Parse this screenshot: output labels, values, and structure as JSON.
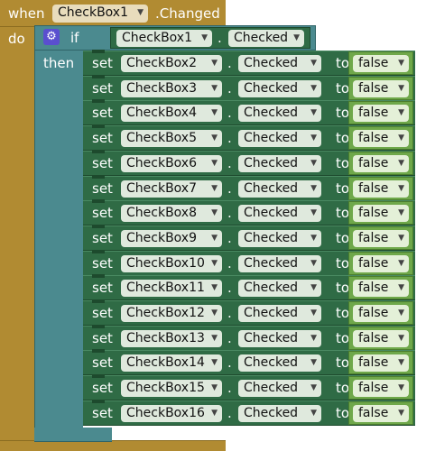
{
  "event": {
    "when_label": "when",
    "component": "CheckBox1",
    "event_name": ".Changed",
    "do_label": "do"
  },
  "if_block": {
    "if_label": "if",
    "then_label": "then",
    "component": "CheckBox1",
    "dot": ".",
    "property": "Checked"
  },
  "rows": [
    {
      "set_label": "set",
      "component": "CheckBox2",
      "dot": ".",
      "property": "Checked",
      "to_label": "to",
      "value": "false"
    },
    {
      "set_label": "set",
      "component": "CheckBox3",
      "dot": ".",
      "property": "Checked",
      "to_label": "to",
      "value": "false"
    },
    {
      "set_label": "set",
      "component": "CheckBox4",
      "dot": ".",
      "property": "Checked",
      "to_label": "to",
      "value": "false"
    },
    {
      "set_label": "set",
      "component": "CheckBox5",
      "dot": ".",
      "property": "Checked",
      "to_label": "to",
      "value": "false"
    },
    {
      "set_label": "set",
      "component": "CheckBox6",
      "dot": ".",
      "property": "Checked",
      "to_label": "to",
      "value": "false"
    },
    {
      "set_label": "set",
      "component": "CheckBox7",
      "dot": ".",
      "property": "Checked",
      "to_label": "to",
      "value": "false"
    },
    {
      "set_label": "set",
      "component": "CheckBox8",
      "dot": ".",
      "property": "Checked",
      "to_label": "to",
      "value": "false"
    },
    {
      "set_label": "set",
      "component": "CheckBox9",
      "dot": ".",
      "property": "Checked",
      "to_label": "to",
      "value": "false"
    },
    {
      "set_label": "set",
      "component": "CheckBox10",
      "dot": ".",
      "property": "Checked",
      "to_label": "to",
      "value": "false"
    },
    {
      "set_label": "set",
      "component": "CheckBox11",
      "dot": ".",
      "property": "Checked",
      "to_label": "to",
      "value": "false"
    },
    {
      "set_label": "set",
      "component": "CheckBox12",
      "dot": ".",
      "property": "Checked",
      "to_label": "to",
      "value": "false"
    },
    {
      "set_label": "set",
      "component": "CheckBox13",
      "dot": ".",
      "property": "Checked",
      "to_label": "to",
      "value": "false"
    },
    {
      "set_label": "set",
      "component": "CheckBox14",
      "dot": ".",
      "property": "Checked",
      "to_label": "to",
      "value": "false"
    },
    {
      "set_label": "set",
      "component": "CheckBox15",
      "dot": ".",
      "property": "Checked",
      "to_label": "to",
      "value": "false"
    },
    {
      "set_label": "set",
      "component": "CheckBox16",
      "dot": ".",
      "property": "Checked",
      "to_label": "to",
      "value": "false"
    }
  ],
  "icons": {
    "dropdown": "dropdown-arrow-icon",
    "mutator": "gear-icon"
  },
  "colors": {
    "event": "#b18b32",
    "control": "#4b8a8f",
    "setter": "#2f6b45",
    "boolean": "#6fa84a"
  }
}
